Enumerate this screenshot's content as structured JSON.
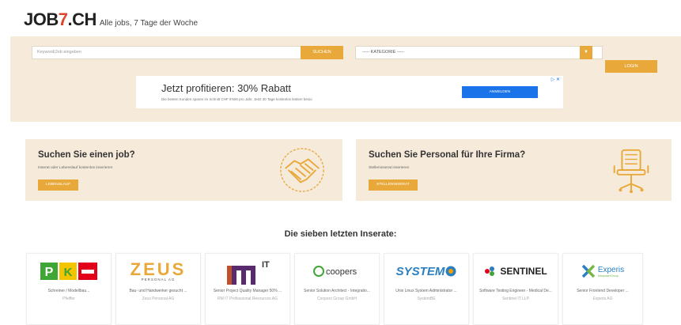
{
  "header": {
    "logo_prefix": "JOB",
    "logo_seven": "7",
    "logo_suffix": ".CH",
    "tagline": "Alle jobs, 7 Tage der Woche"
  },
  "search": {
    "placeholder": "Keyword/Job eingeben",
    "button": "SUCHEN",
    "category_label": "----- KATEGORIE -----",
    "login": "LOGIN"
  },
  "ad": {
    "title": "Jetzt profitieren: 30% Rabatt",
    "subtitle": "Die besten Kunden sparen im Schnitt CHF 5'500 pro Jahr. Jetzt 30 Tage kostenlos testen! bexio",
    "button": "ANMELDEN",
    "marker": "▷ ✕"
  },
  "promo_left": {
    "title": "Suchen Sie einen job?",
    "subtitle": "Inserat oder Lebenslauf kostenlos inserieren",
    "button": "LEBENSLAUF"
  },
  "promo_right": {
    "title": "Suchen Sie Personal für Ihre Firma?",
    "subtitle": "Stelleninserat inserieren",
    "button": "STELLENINSERAT"
  },
  "listings_title": "Die sieben letzten Inserate:",
  "listings": [
    {
      "title": "Schreiner / Modellbau...",
      "company": "Pfeiffer"
    },
    {
      "title": "Bau- und Handwerker gesucht ...",
      "company": "Zeus Personal AG"
    },
    {
      "title": "Senior Project Quality Manager 50% ...",
      "company": "RM IT Professional Resources AG"
    },
    {
      "title": "Senior Solution Architect - Integratio...",
      "company": "Coopers Group GmbH"
    },
    {
      "title": "Unix Linux System Administrator ...",
      "company": "SystemBE"
    },
    {
      "title": "Software Testing Engineer - Medical De...",
      "company": "Sentinel IT LLP"
    },
    {
      "title": "Senior Frontend Developer ...",
      "company": "Experis AG"
    }
  ],
  "logos": {
    "zeus_big": "ZEUS",
    "zeus_small": "PERSONAL AG",
    "rm_sup": "IT",
    "coopers": "coopers",
    "system": "SYSTEM",
    "sentinel": "SENTINEL",
    "experis": "Experis",
    "experis_sub": "ManpowerGroup"
  },
  "colors": {
    "accent": "#e8a93a",
    "band": "#f6eadb",
    "logo_red": "#e0462e",
    "ad_blue": "#1a73e8"
  }
}
